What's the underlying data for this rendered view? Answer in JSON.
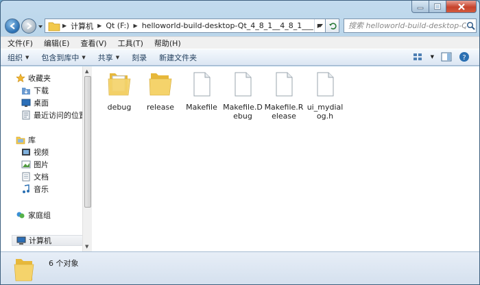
{
  "address": {
    "crumbs": [
      "计算机",
      "Qt (F:)",
      "helloworld-build-desktop-Qt_4_8_1__4_8_1___"
    ]
  },
  "search": {
    "placeholder": "搜索 helloworld-build-desktop-Qt..."
  },
  "menu": [
    "文件(F)",
    "编辑(E)",
    "查看(V)",
    "工具(T)",
    "帮助(H)"
  ],
  "commands": {
    "organize": "组织",
    "include": "包含到库中",
    "share": "共享",
    "burn": "刻录",
    "new_folder": "新建文件夹"
  },
  "nav": {
    "favorites": "收藏夹",
    "downloads": "下载",
    "desktop": "桌面",
    "recent": "最近访问的位置",
    "libraries": "库",
    "videos": "视频",
    "pictures": "图片",
    "documents": "文档",
    "music": "音乐",
    "homegroup": "家庭组",
    "computer": "计算机"
  },
  "files": [
    {
      "name": "debug",
      "type": "folder"
    },
    {
      "name": "release",
      "type": "folder"
    },
    {
      "name": "Makefile",
      "type": "file"
    },
    {
      "name": "Makefile.Debug",
      "type": "file"
    },
    {
      "name": "Makefile.Release",
      "type": "file"
    },
    {
      "name": "ui_mydialog.h",
      "type": "file"
    }
  ],
  "status": {
    "count": "6 个对象"
  },
  "colors": {
    "folder": "#f2c94c",
    "accent": "#2a6fb2",
    "close": "#c6432c"
  }
}
